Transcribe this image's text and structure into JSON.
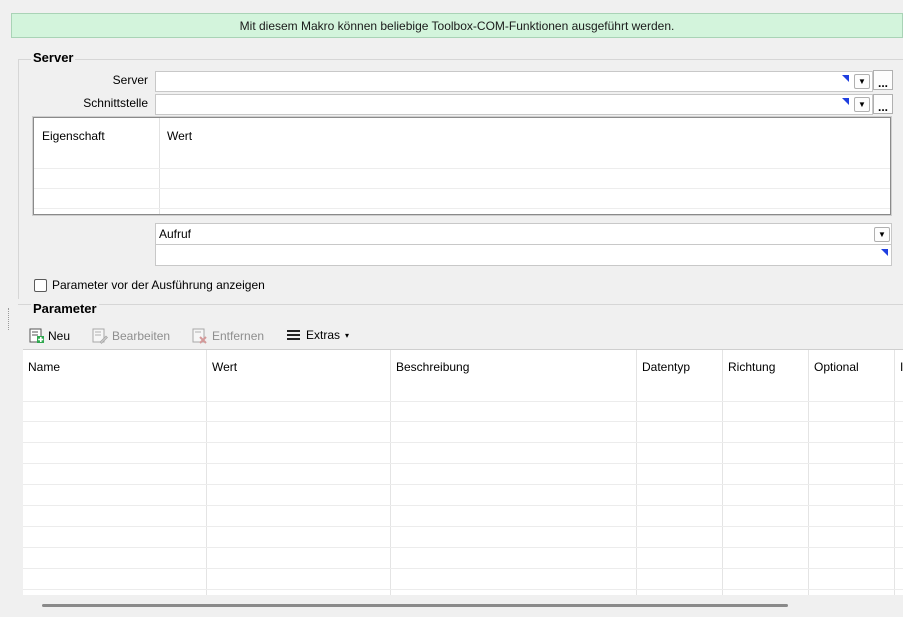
{
  "banner": {
    "text": "Mit diesem Makro können beliebige Toolbox-COM-Funktionen ausgeführt werden."
  },
  "server_group": {
    "title": "Server",
    "server_label": "Server",
    "server_value": "",
    "interface_label": "Schnittstelle",
    "interface_value": "",
    "more_button": "...",
    "property_grid": {
      "col_property": "Eigenschaft",
      "col_value": "Wert"
    },
    "call_combo": {
      "value": "Aufruf"
    },
    "call_text": "",
    "show_params_checkbox": {
      "label": "Parameter vor der Ausführung anzeigen",
      "checked": false
    }
  },
  "parameter_group": {
    "title": "Parameter",
    "toolbar": {
      "new": "Neu",
      "edit": "Bearbeiten",
      "remove": "Entfernen",
      "extras": "Extras",
      "extras_arrow": "▾"
    },
    "columns": [
      "Name",
      "Wert",
      "Beschreibung",
      "Datentyp",
      "Richtung",
      "Optional",
      "I"
    ]
  },
  "colors": {
    "banner_bg": "#d3f4dc",
    "window_bg": "#f0f0f0",
    "indicator_blue": "#1f3fe0",
    "new_icon_green": "#2fa84f"
  }
}
